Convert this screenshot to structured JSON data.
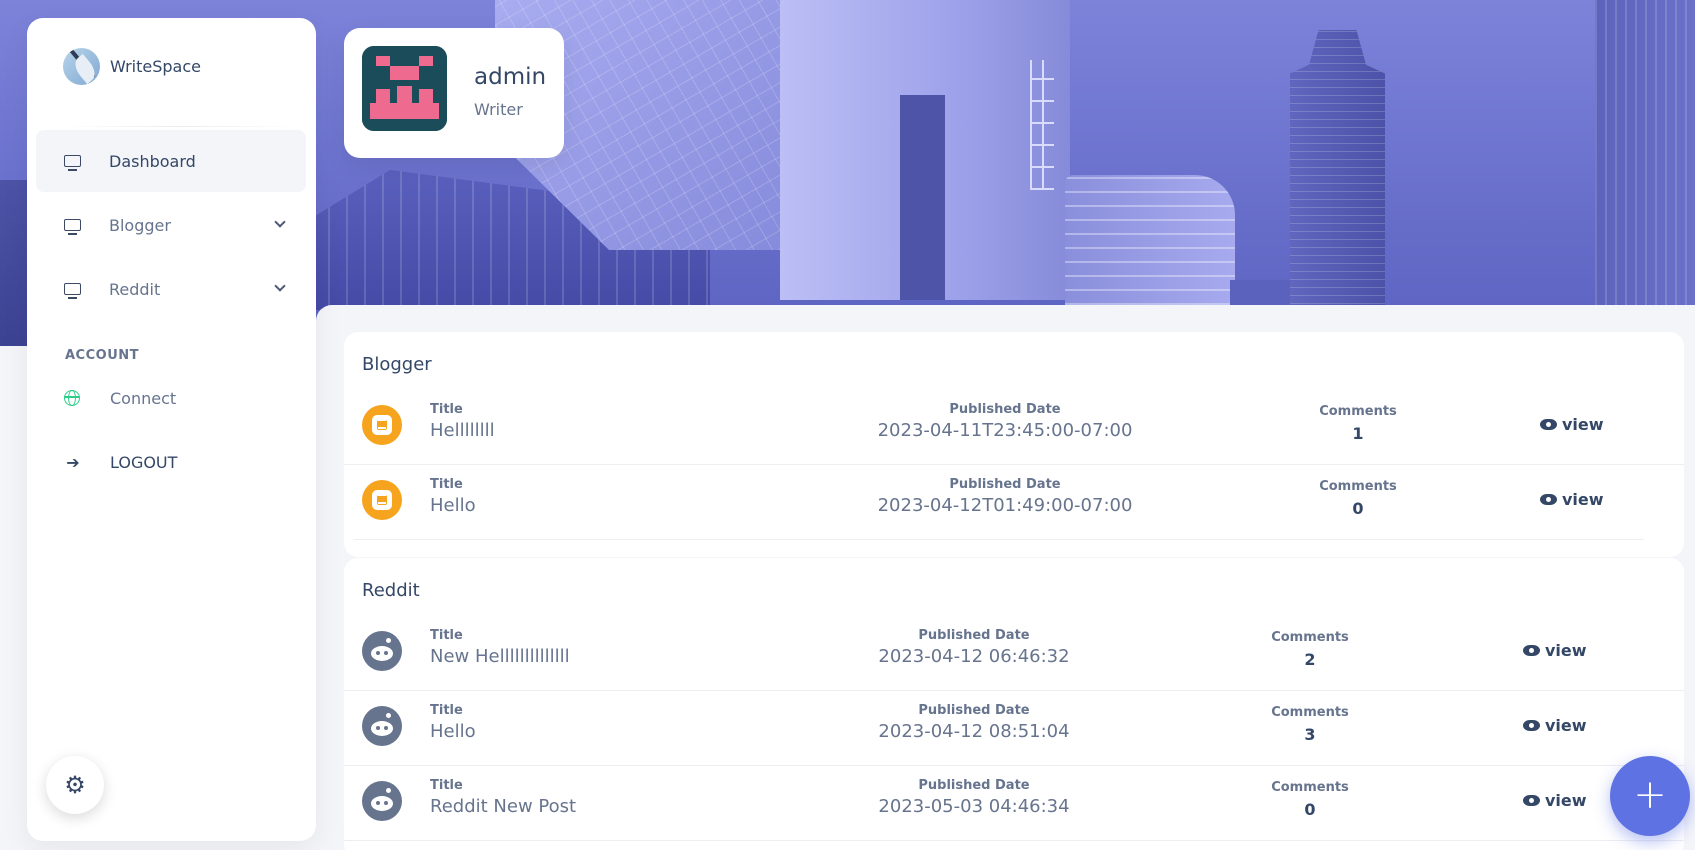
{
  "brand": {
    "name": "WriteSpace",
    "logo_icon": "quill-logo-icon"
  },
  "sidebar": {
    "items": [
      {
        "label": "Dashboard",
        "icon": "monitor-icon",
        "active": true
      },
      {
        "label": "Blogger",
        "icon": "monitor-icon",
        "expandable": true
      },
      {
        "label": "Reddit",
        "icon": "monitor-icon",
        "expandable": true
      }
    ],
    "account_section": "ACCOUNT",
    "account_items": [
      {
        "label": "Connect",
        "icon": "globe-icon"
      },
      {
        "label": "LOGOUT",
        "icon": "logout-icon"
      }
    ],
    "settings_icon": "gear-icon"
  },
  "profile": {
    "name": "admin",
    "role": "Writer"
  },
  "blogger": {
    "title": "Blogger",
    "labels": {
      "title": "Title",
      "published": "Published Date",
      "comments": "Comments",
      "view": "view"
    },
    "posts": [
      {
        "title": "Hellllllll",
        "published": "2023-04-11T23:45:00-07:00",
        "comments": "1"
      },
      {
        "title": "Hello",
        "published": "2023-04-12T01:49:00-07:00",
        "comments": "0"
      }
    ]
  },
  "reddit": {
    "title": "Reddit",
    "labels": {
      "title": "Title",
      "published": "Published Date",
      "comments": "Comments",
      "view": "view"
    },
    "posts": [
      {
        "title": "New Hellllllllllllll",
        "published": "2023-04-12 06:46:32",
        "comments": "2"
      },
      {
        "title": "Hello",
        "published": "2023-04-12 08:51:04",
        "comments": "3"
      },
      {
        "title": "Reddit New Post",
        "published": "2023-05-03 04:46:34",
        "comments": "0"
      }
    ]
  },
  "fab": {
    "label": "+",
    "icon": "plus-icon"
  },
  "colors": {
    "primary": "#5e72e4",
    "text_dark": "#344767",
    "text_muted": "#67748e",
    "blogger": "#f6a31d",
    "connect": "#2dce89"
  }
}
